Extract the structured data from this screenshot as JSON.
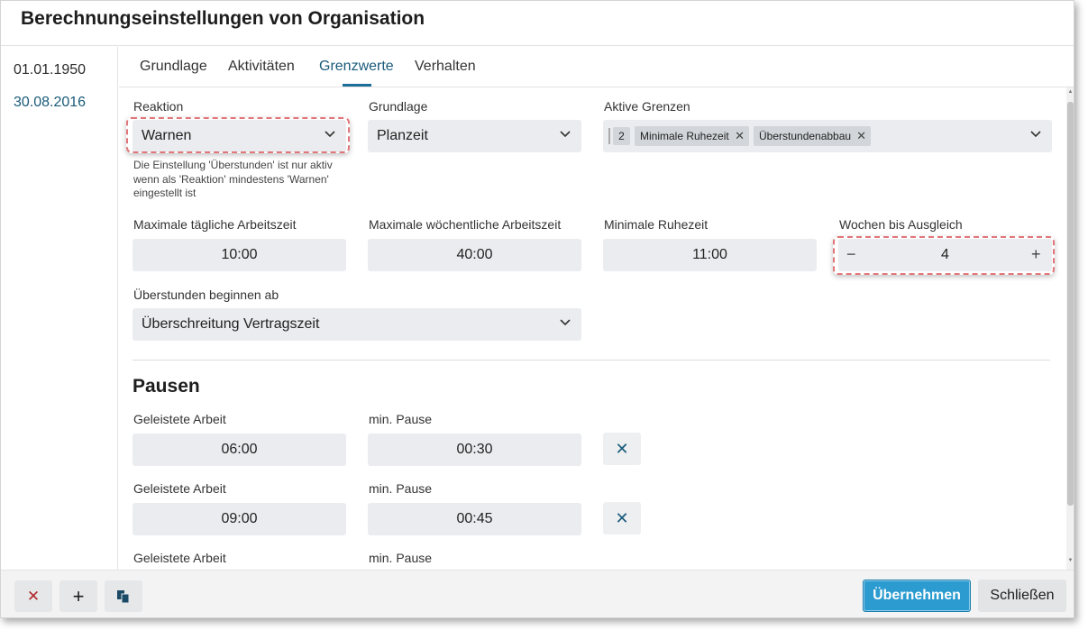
{
  "dialog": {
    "title": "Berechnungseinstellungen von Organisation"
  },
  "sidebar": {
    "dates": [
      {
        "label": "01.01.1950"
      },
      {
        "label": "30.08.2016"
      }
    ]
  },
  "tabs": [
    {
      "label": "Grundlage"
    },
    {
      "label": "Aktivitäten"
    },
    {
      "label": "Grenzwerte"
    },
    {
      "label": "Verhalten"
    }
  ],
  "form": {
    "reaktion": {
      "label": "Reaktion",
      "value": "Warnen",
      "hint": "Die Einstellung 'Überstunden' ist nur aktiv wenn als 'Reaktion' mindestens 'Warnen' eingestellt ist"
    },
    "grundlage": {
      "label": "Grundlage",
      "value": "Planzeit"
    },
    "aktive_grenzen": {
      "label": "Aktive Grenzen",
      "count": "2",
      "chips": [
        "Minimale Ruhezeit",
        "Überstundenabbau"
      ]
    },
    "max_taeglich": {
      "label": "Maximale tägliche Arbeitszeit",
      "value": "10:00"
    },
    "max_woechentlich": {
      "label": "Maximale wöchentliche Arbeitszeit",
      "value": "40:00"
    },
    "min_ruhezeit": {
      "label": "Minimale Ruhezeit",
      "value": "11:00"
    },
    "wochen_ausgleich": {
      "label": "Wochen bis Ausgleich",
      "value": "4",
      "minus": "−",
      "plus": "+"
    },
    "ueberstunden": {
      "label": "Überstunden beginnen ab",
      "value": "Überschreitung Vertragszeit"
    }
  },
  "pausen": {
    "title": "Pausen",
    "col_work": "Geleistete Arbeit",
    "col_pause": "min. Pause",
    "rows": [
      {
        "work": "06:00",
        "pause": "00:30"
      },
      {
        "work": "09:00",
        "pause": "00:45"
      },
      {
        "work": "",
        "pause": ""
      }
    ]
  },
  "footer": {
    "apply": "Übernehmen",
    "close": "Schließen"
  },
  "colors": {
    "accent": "#1a5b7a",
    "primary_button": "#2b9bd0",
    "highlight_dash": "#e0767a"
  }
}
